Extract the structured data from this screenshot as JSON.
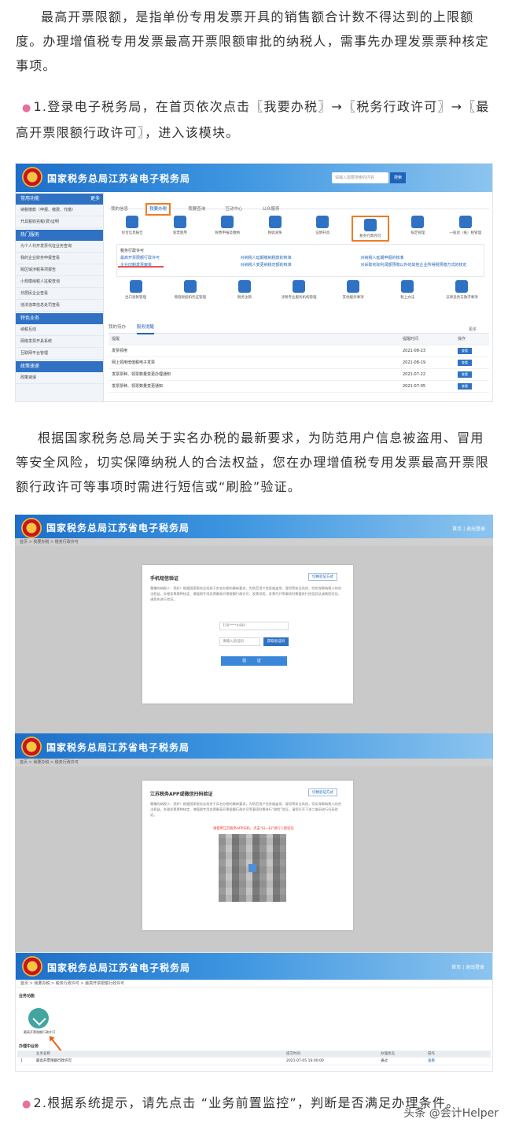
{
  "para1": "最高开票限额，是指单份专用发票开具的销售额合计数不得达到的上限额度。办理增值税专用发票最高开票限额审批的纳税人，需事先办理发票票种核定事项。",
  "step1": {
    "bullet": "●",
    "text": "1.登录电子税务局，在首页依次点击〖我要办税〗→〖税务行政许可〗→〖最高开票限额行政许可〗，进入该模块。"
  },
  "shot1": {
    "banner_title": "国家税务总局江苏省电子税务局",
    "search_placeholder": "请输入需要搜索的内容",
    "search_btn": "搜索",
    "sidebar": {
      "head1": "常用功能",
      "head1_more": "更多",
      "items1": [
        "纳税缴款（申报、缴费、代缴）",
        "开具税收完税(费)证明"
      ],
      "head2": "热门服务",
      "items2": [
        "为个人代开发票代征业务查询",
        "我的企业财务申报查看",
        "跨区域涉税事项报告",
        "小规模纳税人征税查询",
        "非居民企业查看",
        "违法违章信息处罚查看"
      ],
      "head3": "特色业务",
      "items3": [
        "纳税互动",
        "网络发票开具系统",
        "互联网平台管理"
      ],
      "head4": "政策速递",
      "items4": [
        "政策速递"
      ]
    },
    "tabs": [
      "我的信息",
      "我要办税",
      "我要查询",
      "互动中心",
      "公众服务"
    ],
    "icons_row1": [
      "综合信息报告",
      "发票使用",
      "税费申报及缴纳",
      "税收减免",
      "证明开具",
      "税务行政许可",
      "核定管理",
      "一般退（抵）税管理"
    ],
    "sublinks_title": "税务行政许可",
    "sublinks": [
      [
        "最高开票限额行政许可",
        "对纳税人延期缴纳税款的核准",
        "对纳税人延期申报的核准"
      ],
      [
        "企业印制发票审批",
        "对纳税人变更纳税定额的核准",
        "对采取实际利润额预缴以外的其他企业所得税预缴方式的核定"
      ]
    ],
    "icons_row2": [
      "出口退税管理",
      "增值税抵扣凭证管理",
      "税务注销",
      "涉税专业服务机构管理",
      "其他服务事项",
      "税上办法",
      "法律追责与救济事项"
    ],
    "table_tabs": [
      "我的待办",
      "服务提醒"
    ],
    "table_more": "更多",
    "table_head": [
      "提醒",
      "提醒时间",
      "操作"
    ],
    "rows": [
      {
        "title": "发票领用",
        "date": "2021-08-23",
        "op": "查看"
      },
      {
        "title": "网上领用增值税电子发票",
        "date": "2021-08-19",
        "op": "查看"
      },
      {
        "title": "发票票种、领票数量变更办理通知",
        "date": "2021-07-22",
        "op": "查看"
      },
      {
        "title": "发票票种、领票数量变更通知",
        "date": "2021-07-05",
        "op": "查看"
      }
    ]
  },
  "para2": "根据国家税务总局关于实名办税的最新要求，为防范用户信息被盗用、冒用等安全风险，切实保障纳税人的合法权益，您在办理增值税专用发票最高开票限额行政许可等事项时需进行短信或“刷脸”验证。",
  "shot2": {
    "banner_title": "国家税务总局江苏省电子税务局",
    "user_info": "首页 | 退出登录",
    "crumb": "首页 > 我要办税 > 税务行政许可",
    "modal_title": "手机短信验证",
    "modal_switch": "切换验证方式",
    "modal_text": "尊敬的纳税人：您好！根据国家税务总局关于实名办税的最新要求，为防范用户信息被盗用、冒用等安全风险，切实保障纳税人的合法权益，办理发票票种核定、增值税专用发票最高开票限额行政许可、发票领用、发票代开等事项时需要进行短信验证或刷脸验证，请您先进行验证。",
    "phone_value": "158****4484",
    "code_placeholder": "请输入验证码",
    "code_btn": "获取验证码",
    "verify_btn": "验 证"
  },
  "shot3": {
    "banner_title": "国家税务总局江苏省电子税务局",
    "crumb": "首页 > 我要办税 > 税务行政许可",
    "modal_title": "江苏税务APP或微信扫码验证",
    "modal_switch": "切换验证方式",
    "modal_text": "尊敬的纳税人：您好！根据国家税务总局关于实名办税的最新要求，为防范用户信息被盗用、冒用等安全风险，切实保障纳税人的合法权益，办理发票票种核定、增值税专用发票最高开票限额行政许可等事项时需进行“刷脸”验证，请您打开下述二维码进行扫码验证。",
    "red_tip": "请使用江苏税务APP扫码，点击“扫一扫”进行人脸验证"
  },
  "shot4": {
    "banner_title": "国家税务总局江苏省电子税务局",
    "user_info": "首页 | 退出登录",
    "crumb": "首页 > 我要办税 > 税务行政许可 > 最高开票限额行政许可",
    "section1": "业务功能",
    "app_label": "最高开票限额行政许可",
    "section2": "办理中业务",
    "table_head": [
      "业务名称",
      "提交时间",
      "办理状态",
      "操作"
    ],
    "rows": [
      {
        "no": "1",
        "name": "最高开票限额行政许可",
        "time": "2021-07-05 16:00:00",
        "status": "通过",
        "op": "查看"
      }
    ]
  },
  "step2": {
    "bullet": "●",
    "text": "2.根据系统提示，请先点击 “业务前置监控”，判断是否满足办理条件。"
  },
  "watermark": "头条 @会计Helper"
}
